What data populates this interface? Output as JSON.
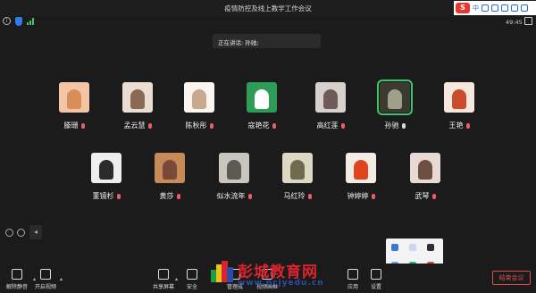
{
  "window": {
    "title": "疫情防控及线上教学工作会议"
  },
  "ime": {
    "logo": "S",
    "mode": "中",
    "items": [
      "•",
      "‥"
    ]
  },
  "status": {
    "time": "49:45",
    "info": "i"
  },
  "banner": {
    "speaking_text": "正在讲话: 孙驰;"
  },
  "participants": [
    {
      "name": "滕珊",
      "mic": "muted",
      "avatar_colors": [
        "#f2c5a6",
        "#d98d5a"
      ]
    },
    {
      "name": "孟云慧",
      "mic": "muted",
      "avatar_colors": [
        "#e9ded1",
        "#8a6a55"
      ]
    },
    {
      "name": "陈秋彤",
      "mic": "muted",
      "avatar_colors": [
        "#faf6ef",
        "#c9a98d"
      ]
    },
    {
      "name": "寇艳花",
      "mic": "muted",
      "avatar_colors": [
        "#2e9b57",
        "#ffffff"
      ]
    },
    {
      "name": "高红莲",
      "mic": "muted",
      "avatar_colors": [
        "#d7d0cc",
        "#6f5c58"
      ]
    },
    {
      "name": "孙驰",
      "mic": "on",
      "speaking": true,
      "avatar_colors": [
        "#3a3a30",
        "#9fa08a"
      ]
    },
    {
      "name": "王艳",
      "mic": "muted",
      "avatar_colors": [
        "#f7e7dc",
        "#c94c2c"
      ]
    },
    {
      "name": "董镜杉",
      "mic": "muted",
      "avatar_colors": [
        "#eeeeee",
        "#2b2b2b"
      ]
    },
    {
      "name": "黄莎",
      "mic": "muted",
      "avatar_colors": [
        "#c98a5a",
        "#7a4a38"
      ]
    },
    {
      "name": "似水流年",
      "mic": "muted",
      "avatar_colors": [
        "#c9c6bd",
        "#5b5a53"
      ]
    },
    {
      "name": "马红玲",
      "mic": "muted",
      "avatar_colors": [
        "#dcd8c4",
        "#6e6a4e"
      ]
    },
    {
      "name": "钟婷婷",
      "mic": "muted",
      "avatar_colors": [
        "#f2ece2",
        "#e0441f"
      ]
    },
    {
      "name": "武琴",
      "mic": "muted",
      "avatar_colors": [
        "#e6dad3",
        "#6d4f44"
      ]
    }
  ],
  "toolbar": {
    "buttons": [
      {
        "label": "解除静音",
        "icon": "mic-off-icon"
      },
      {
        "label": "开启视频",
        "icon": "camera-off-icon"
      },
      {
        "label": "共享屏幕",
        "icon": "share-screen-icon"
      },
      {
        "label": "安全",
        "icon": "shield-icon"
      },
      {
        "label": "管理成",
        "icon": "members-icon"
      },
      {
        "label": "视频画框",
        "icon": "layout-icon"
      },
      {
        "label": "应用",
        "icon": "apps-icon"
      },
      {
        "label": "设置",
        "icon": "gear-icon"
      }
    ],
    "end_label": "结束会议"
  },
  "watermark": {
    "text": "彭城教育网",
    "url": "www.pcjyedu.cn"
  }
}
